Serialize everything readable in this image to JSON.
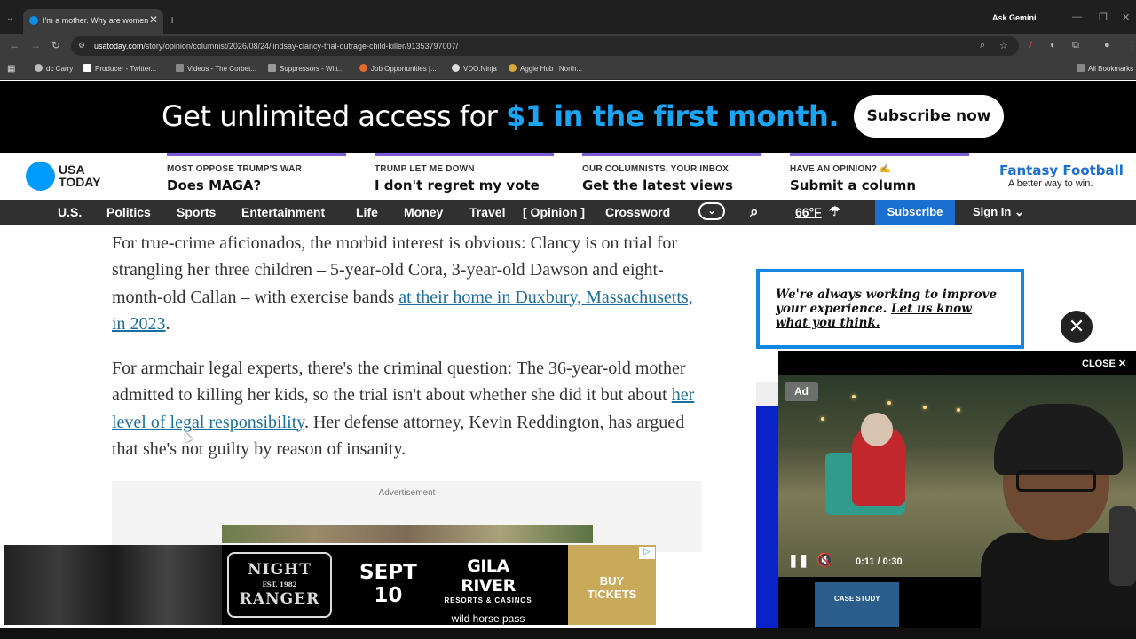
{
  "browser": {
    "tab_title": "I'm a mother. Why are women",
    "tab_close": "✕",
    "new_tab": "+",
    "ask_gemini": "Ask Gemini",
    "url_domain": "usatoday.com",
    "url_path": "/story/opinion/columnist/2026/08/24/lindsay-clancy-trial-outrage-child-killer/91353797007/",
    "bookmarks": [
      "dc Carry",
      "Producer - Twitter...",
      "Videos - The Corbet...",
      "Suppressors - Witt...",
      "Job Opportunities |...",
      "VDO.Ninja",
      "Aggie Hub | North..."
    ],
    "all_bookmarks": "All Bookmarks"
  },
  "promo": {
    "text_lead": "Get unlimited access for ",
    "text_highlight": "$1 in the first month.",
    "button": "Subscribe now",
    "highlight_color": "#19a5f2"
  },
  "header": {
    "logo_line1": "USA",
    "logo_line2": "TODAY",
    "promos": [
      {
        "eyebrow": "MOST OPPOSE TRUMP'S WAR",
        "headline": "Does MAGA?"
      },
      {
        "eyebrow": "TRUMP LET ME DOWN",
        "headline": "I don't regret my vote"
      },
      {
        "eyebrow": "OUR COLUMNISTS, YOUR INBOX",
        "headline": "Get the latest views"
      },
      {
        "eyebrow": "HAVE AN OPINION? ✍",
        "headline": "Submit a column"
      }
    ],
    "ff_title": "Fantasy Football",
    "ff_sub": "A better way to win."
  },
  "nav": {
    "items": [
      "U.S.",
      "Politics",
      "Sports",
      "Entertainment",
      "Life",
      "Money",
      "Travel",
      "[ Opinion ]",
      "Crossword"
    ],
    "weather": "66°F",
    "subscribe": "Subscribe",
    "signin": "Sign In",
    "accent": "#1a6fd1"
  },
  "article": {
    "p1_a": "For true-crime aficionados, the morbid interest is obvious: Clancy is on trial for strangling her three children – 5-year-old Cora, 3-year-old Dawson and eight-month-old Callan – with exercise bands ",
    "p1_link": "at their home in Duxbury, Massachusetts, in 2023",
    "p1_b": ".",
    "p2_a": "For armchair legal experts, there's the criminal question: The 36-year-old mother admitted to killing her kids, so the trial isn't about whether she did it but about ",
    "p2_link": "her level of legal responsibility",
    "p2_b": ". Her defense attorney, Kevin Reddington, has argued that she's not guilty by reason of insanity.",
    "ad_label": "Advertisement"
  },
  "feedback": {
    "text": "We're always working to improve your experience. ",
    "link": "Let us know what you think."
  },
  "video": {
    "close": "CLOSE ✕",
    "badge": "Ad",
    "time": "0:11 / 0:30",
    "case_study": "CASE STUDY"
  },
  "bottom_ad": {
    "band_top": "NIGHT",
    "band_est": "EST. 1982",
    "band_bottom": "RANGER",
    "date_line1": "SEPT",
    "date_line2": "10",
    "venue_line1": "GILA RIVER",
    "venue_line2": "RESORTS & CASINOS",
    "venue_line3": "wild horse pass",
    "cta_line1": "BUY",
    "cta_line2": "TICKETS"
  }
}
